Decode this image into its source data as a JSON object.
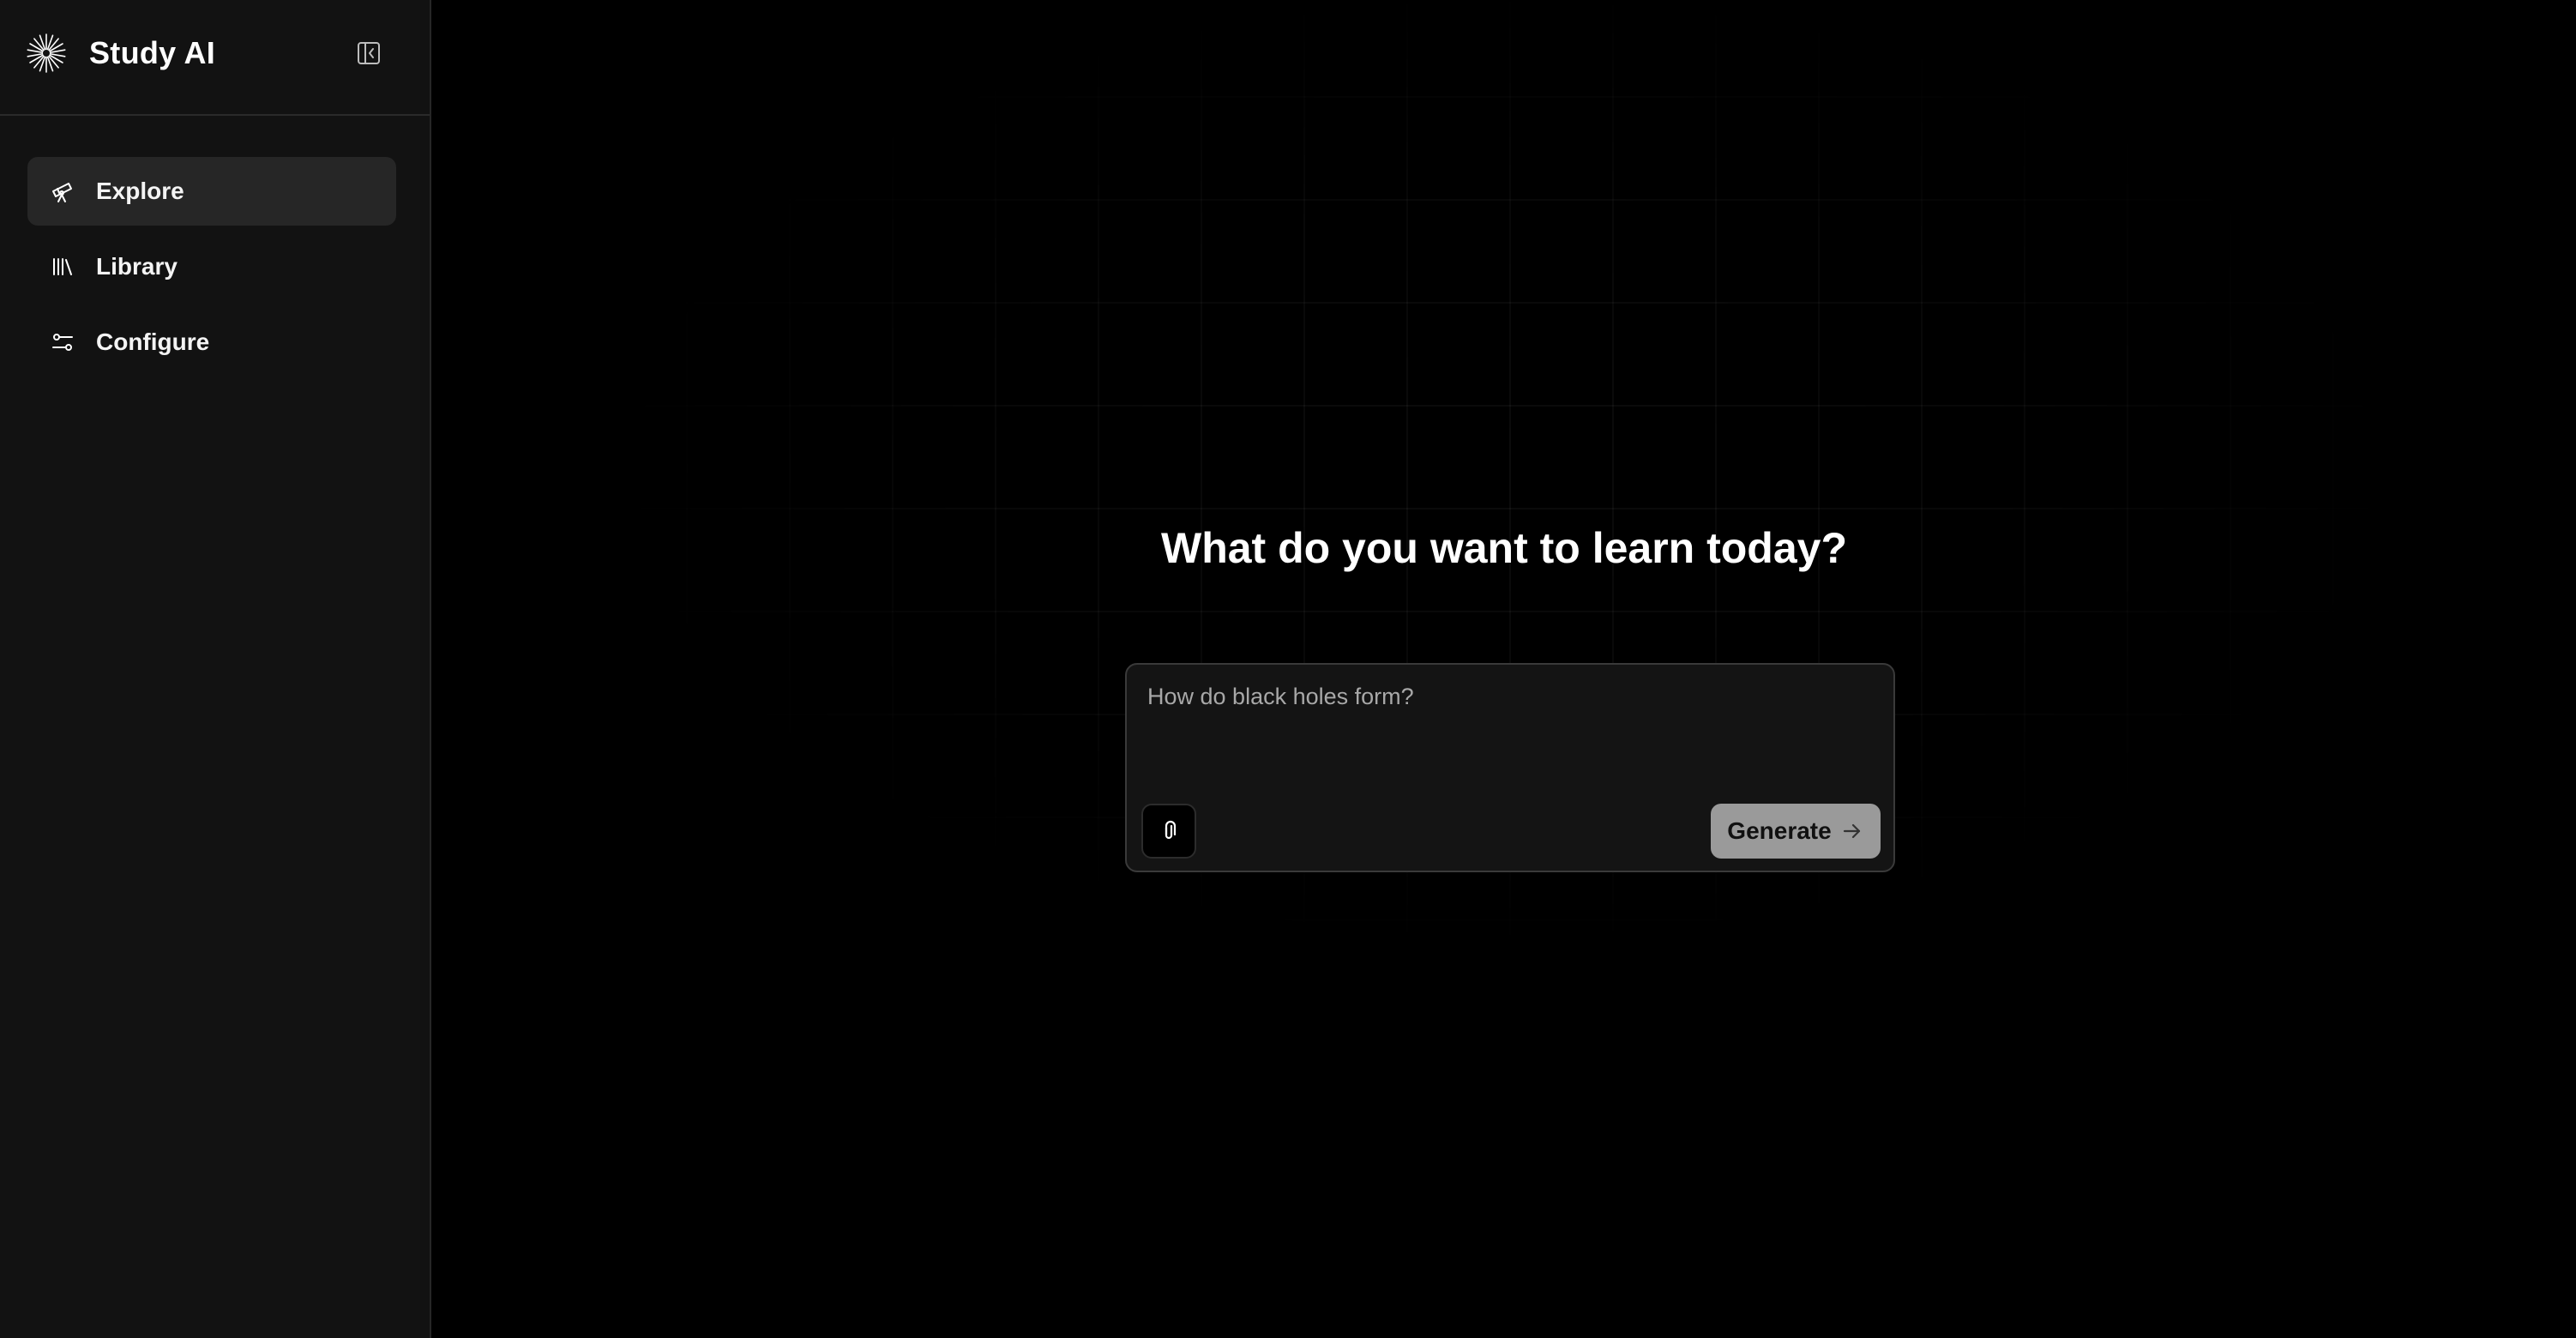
{
  "app": {
    "title": "Study AI",
    "logo_icon": "sunburst-logo-icon",
    "collapse_icon": "sidebar-collapse-icon"
  },
  "sidebar": {
    "items": [
      {
        "label": "Explore",
        "icon": "telescope-icon",
        "active": true
      },
      {
        "label": "Library",
        "icon": "library-icon",
        "active": false
      },
      {
        "label": "Configure",
        "icon": "sliders-icon",
        "active": false
      }
    ]
  },
  "main": {
    "headline": "What do you want to learn today?",
    "prompt": {
      "placeholder": "How do black holes form?",
      "value": "",
      "attach_icon": "paperclip-icon",
      "generate_label": "Generate",
      "generate_icon": "arrow-right-icon"
    }
  },
  "colors": {
    "background": "#000000",
    "sidebar": "#121212",
    "active_item": "#262626",
    "generate_button": "#9a9a9a"
  }
}
